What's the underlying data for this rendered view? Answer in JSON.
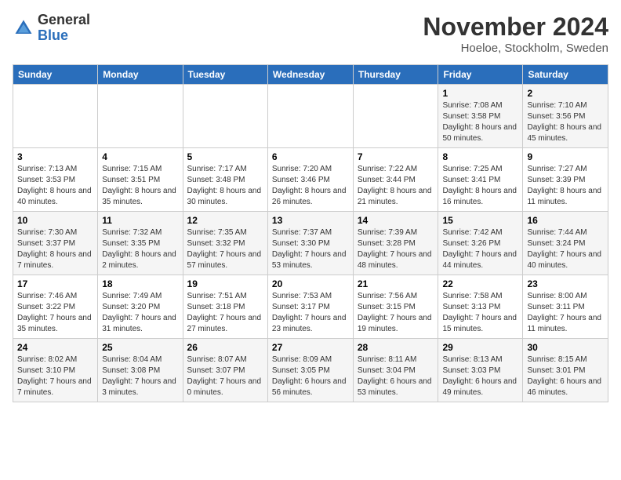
{
  "header": {
    "logo_general": "General",
    "logo_blue": "Blue",
    "month_title": "November 2024",
    "location": "Hoeloe, Stockholm, Sweden"
  },
  "weekdays": [
    "Sunday",
    "Monday",
    "Tuesday",
    "Wednesday",
    "Thursday",
    "Friday",
    "Saturday"
  ],
  "weeks": [
    [
      {
        "day": "",
        "info": ""
      },
      {
        "day": "",
        "info": ""
      },
      {
        "day": "",
        "info": ""
      },
      {
        "day": "",
        "info": ""
      },
      {
        "day": "",
        "info": ""
      },
      {
        "day": "1",
        "info": "Sunrise: 7:08 AM\nSunset: 3:58 PM\nDaylight: 8 hours and 50 minutes."
      },
      {
        "day": "2",
        "info": "Sunrise: 7:10 AM\nSunset: 3:56 PM\nDaylight: 8 hours and 45 minutes."
      }
    ],
    [
      {
        "day": "3",
        "info": "Sunrise: 7:13 AM\nSunset: 3:53 PM\nDaylight: 8 hours and 40 minutes."
      },
      {
        "day": "4",
        "info": "Sunrise: 7:15 AM\nSunset: 3:51 PM\nDaylight: 8 hours and 35 minutes."
      },
      {
        "day": "5",
        "info": "Sunrise: 7:17 AM\nSunset: 3:48 PM\nDaylight: 8 hours and 30 minutes."
      },
      {
        "day": "6",
        "info": "Sunrise: 7:20 AM\nSunset: 3:46 PM\nDaylight: 8 hours and 26 minutes."
      },
      {
        "day": "7",
        "info": "Sunrise: 7:22 AM\nSunset: 3:44 PM\nDaylight: 8 hours and 21 minutes."
      },
      {
        "day": "8",
        "info": "Sunrise: 7:25 AM\nSunset: 3:41 PM\nDaylight: 8 hours and 16 minutes."
      },
      {
        "day": "9",
        "info": "Sunrise: 7:27 AM\nSunset: 3:39 PM\nDaylight: 8 hours and 11 minutes."
      }
    ],
    [
      {
        "day": "10",
        "info": "Sunrise: 7:30 AM\nSunset: 3:37 PM\nDaylight: 8 hours and 7 minutes."
      },
      {
        "day": "11",
        "info": "Sunrise: 7:32 AM\nSunset: 3:35 PM\nDaylight: 8 hours and 2 minutes."
      },
      {
        "day": "12",
        "info": "Sunrise: 7:35 AM\nSunset: 3:32 PM\nDaylight: 7 hours and 57 minutes."
      },
      {
        "day": "13",
        "info": "Sunrise: 7:37 AM\nSunset: 3:30 PM\nDaylight: 7 hours and 53 minutes."
      },
      {
        "day": "14",
        "info": "Sunrise: 7:39 AM\nSunset: 3:28 PM\nDaylight: 7 hours and 48 minutes."
      },
      {
        "day": "15",
        "info": "Sunrise: 7:42 AM\nSunset: 3:26 PM\nDaylight: 7 hours and 44 minutes."
      },
      {
        "day": "16",
        "info": "Sunrise: 7:44 AM\nSunset: 3:24 PM\nDaylight: 7 hours and 40 minutes."
      }
    ],
    [
      {
        "day": "17",
        "info": "Sunrise: 7:46 AM\nSunset: 3:22 PM\nDaylight: 7 hours and 35 minutes."
      },
      {
        "day": "18",
        "info": "Sunrise: 7:49 AM\nSunset: 3:20 PM\nDaylight: 7 hours and 31 minutes."
      },
      {
        "day": "19",
        "info": "Sunrise: 7:51 AM\nSunset: 3:18 PM\nDaylight: 7 hours and 27 minutes."
      },
      {
        "day": "20",
        "info": "Sunrise: 7:53 AM\nSunset: 3:17 PM\nDaylight: 7 hours and 23 minutes."
      },
      {
        "day": "21",
        "info": "Sunrise: 7:56 AM\nSunset: 3:15 PM\nDaylight: 7 hours and 19 minutes."
      },
      {
        "day": "22",
        "info": "Sunrise: 7:58 AM\nSunset: 3:13 PM\nDaylight: 7 hours and 15 minutes."
      },
      {
        "day": "23",
        "info": "Sunrise: 8:00 AM\nSunset: 3:11 PM\nDaylight: 7 hours and 11 minutes."
      }
    ],
    [
      {
        "day": "24",
        "info": "Sunrise: 8:02 AM\nSunset: 3:10 PM\nDaylight: 7 hours and 7 minutes."
      },
      {
        "day": "25",
        "info": "Sunrise: 8:04 AM\nSunset: 3:08 PM\nDaylight: 7 hours and 3 minutes."
      },
      {
        "day": "26",
        "info": "Sunrise: 8:07 AM\nSunset: 3:07 PM\nDaylight: 7 hours and 0 minutes."
      },
      {
        "day": "27",
        "info": "Sunrise: 8:09 AM\nSunset: 3:05 PM\nDaylight: 6 hours and 56 minutes."
      },
      {
        "day": "28",
        "info": "Sunrise: 8:11 AM\nSunset: 3:04 PM\nDaylight: 6 hours and 53 minutes."
      },
      {
        "day": "29",
        "info": "Sunrise: 8:13 AM\nSunset: 3:03 PM\nDaylight: 6 hours and 49 minutes."
      },
      {
        "day": "30",
        "info": "Sunrise: 8:15 AM\nSunset: 3:01 PM\nDaylight: 6 hours and 46 minutes."
      }
    ]
  ]
}
